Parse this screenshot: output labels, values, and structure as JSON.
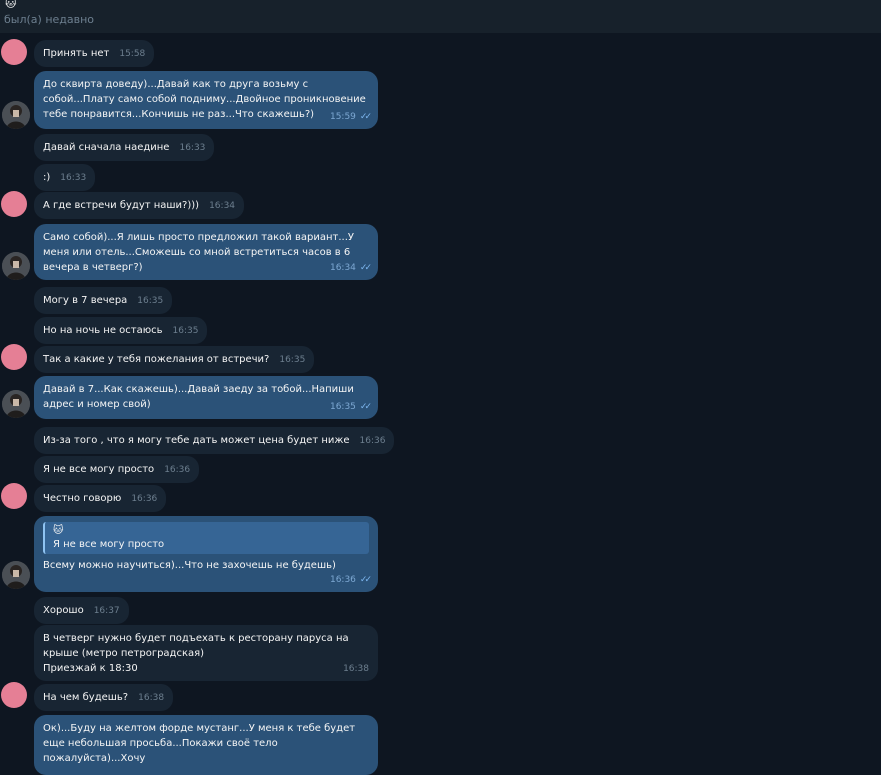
{
  "header": {
    "emoji": "🐱",
    "status": "был(а) недавно"
  },
  "messages": [
    {
      "text": "Принять нет",
      "time": "15:58"
    },
    {
      "text": "До сквирта доведу)...Давай как то друга возьму с собой...Плату само собой подниму...Двойное проникновение тебе понравится...Кончишь не раз...Что скажешь?)",
      "time": "15:59"
    },
    {
      "text": "Давай сначала наедине",
      "time": "16:33"
    },
    {
      "text": ":)",
      "time": "16:33"
    },
    {
      "text": "А где встречи будут наши?)))",
      "time": "16:34"
    },
    {
      "text": "Само собой)...Я лишь просто предложил такой вариант...У меня или отель...Сможешь со мной встретиться часов в 6 вечера в четверг?)",
      "time": "16:34"
    },
    {
      "text": "Могу в 7 вечера",
      "time": "16:35"
    },
    {
      "text": "Но на ночь не остаюсь",
      "time": "16:35"
    },
    {
      "text": "Так а какие у тебя пожелания от встречи?",
      "time": "16:35"
    },
    {
      "text": "Давай в 7...Как скажешь)...Давай заеду за тобой...Напиши адрес и номер свой)",
      "time": "16:35"
    },
    {
      "text": "Из-за того , что я могу тебе дать может цена будет ниже",
      "time": "16:36"
    },
    {
      "text": "Я не все могу просто",
      "time": "16:36"
    },
    {
      "text": "Честно говорю",
      "time": "16:36"
    },
    {
      "reply_emoji": "🐱",
      "reply_text": "Я не все могу просто",
      "text": "Всему можно научиться)...Что не захочешь не будешь)",
      "time": "16:36"
    },
    {
      "text": "Хорошо",
      "time": "16:37"
    },
    {
      "text": "В четверг нужно будет подъехать к ресторану паруса на крыше (метро петроградская)\nПриезжай к 18:30",
      "time": "16:38"
    },
    {
      "text": "На чем будешь?",
      "time": "16:38"
    },
    {
      "text": "Ок)...Буду на желтом форде мустанг...У меня к тебе будет еще небольшая просьба...Покажи своё тело пожалуйста)...Хочу"
    }
  ],
  "colors": {
    "background": "#0e1621",
    "header": "#17212b",
    "incoming_bubble": "#182533",
    "outgoing_bubble": "#2b5278",
    "pink_avatar": "#e57f95",
    "read_checks": "#7eb7f0"
  },
  "icons": {
    "read_receipt": "double-check-icon",
    "contact_avatar": "pink-circle-avatar",
    "user_avatar": "photo-avatar"
  }
}
